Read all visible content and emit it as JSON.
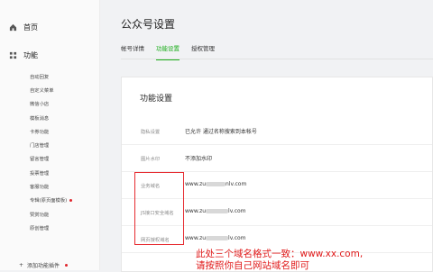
{
  "sidebar": {
    "home": "首页",
    "function": "功能",
    "items": [
      {
        "label": "自动回复",
        "dot": false
      },
      {
        "label": "自定义菜单",
        "dot": false
      },
      {
        "label": "微信小店",
        "dot": false
      },
      {
        "label": "模板消息",
        "dot": false
      },
      {
        "label": "卡券功能",
        "dot": false
      },
      {
        "label": "门店管理",
        "dot": false
      },
      {
        "label": "留言管理",
        "dot": false
      },
      {
        "label": "投票管理",
        "dot": false
      },
      {
        "label": "客服功能",
        "dot": false
      },
      {
        "label": "专辑(原页面模板)",
        "dot": true
      },
      {
        "label": "赞赏功能",
        "dot": false
      },
      {
        "label": "原创管理",
        "dot": false
      }
    ],
    "add_plugin": "添加功能插件"
  },
  "main": {
    "title": "公众号设置",
    "tabs": [
      {
        "label": "帐号详情",
        "active": false
      },
      {
        "label": "功能设置",
        "active": true
      },
      {
        "label": "授权管理",
        "active": false
      }
    ],
    "section_title": "功能设置",
    "rows": [
      {
        "label": "隐私设置",
        "value": "已允许 通过名称搜索到本帐号"
      },
      {
        "label": "图片水印",
        "value": "不添加水印"
      },
      {
        "label": "业务域名",
        "value_prefix": "www.zu",
        "value_suffix": "nlv.com"
      },
      {
        "label": "JS接口安全域名",
        "value_prefix": "www.zu",
        "value_suffix": "lv.com"
      },
      {
        "label": "网页授权域名",
        "value_prefix": "www.zu",
        "value_suffix": "lv.com"
      }
    ]
  },
  "overlay": {
    "line1": "此处三个域名格式一致：www.xx.com,",
    "line2": "请按照你自己网站域名即可"
  },
  "colors": {
    "accent": "#1aad19",
    "annotation": "#e01b1b"
  }
}
